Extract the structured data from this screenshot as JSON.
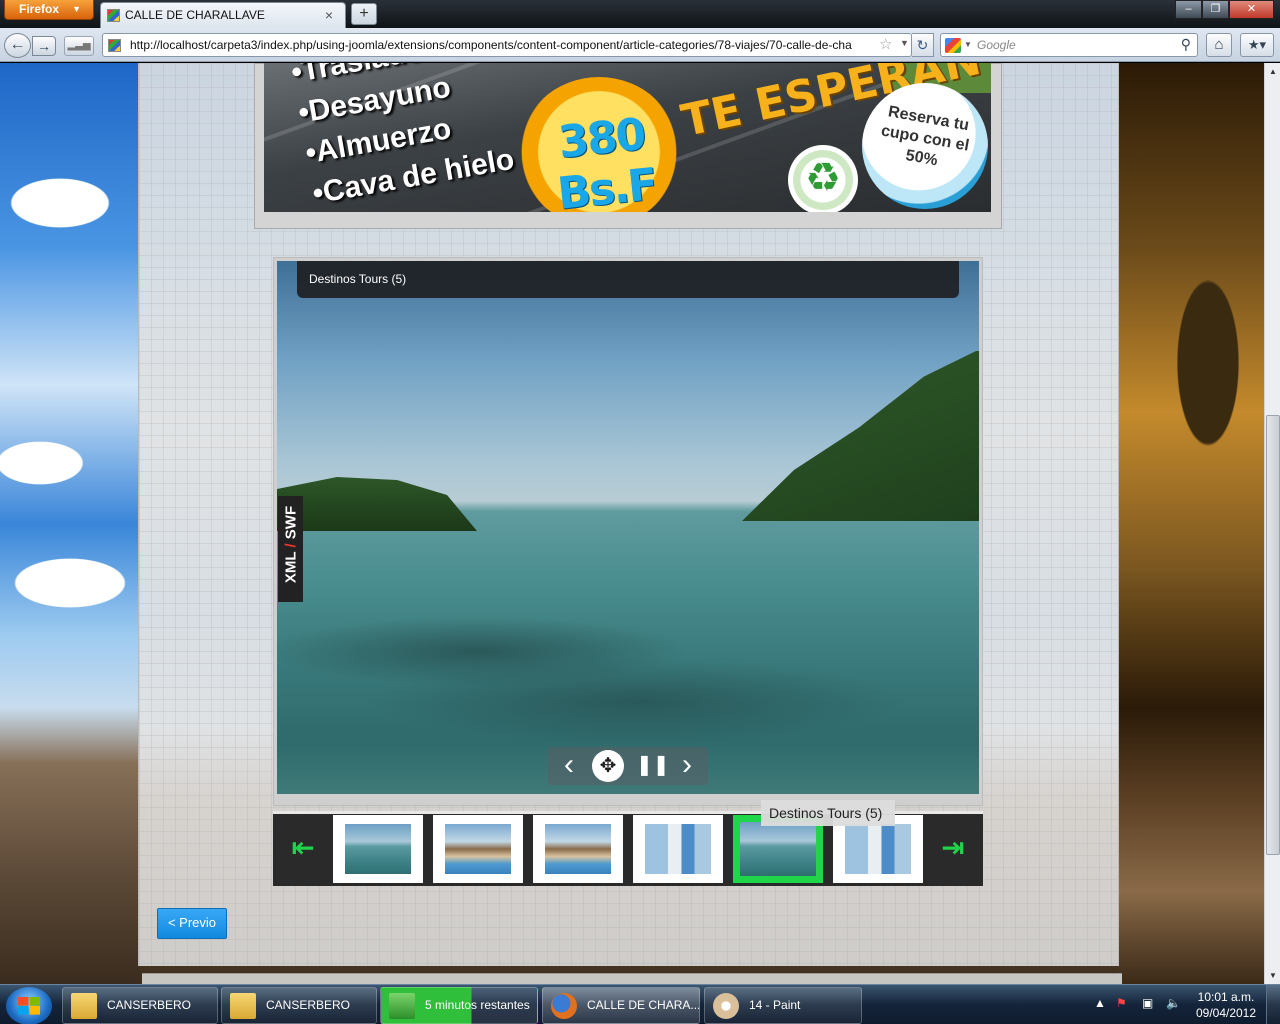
{
  "browser": {
    "app_button": "Firefox",
    "tab_title": "CALLE DE CHARALLAVE",
    "new_tab": "+",
    "url": "http://localhost/carpeta3/index.php/using-joomla/extensions/components/content-component/article-categories/78-viajes/70-calle-de-cha",
    "search_placeholder": "Google"
  },
  "banner": {
    "items": [
      "•Traslado en",
      "•Desayuno",
      "•Almuerzo",
      "•Cava de hielo"
    ],
    "price": "380 Bs.F",
    "headline": "TE ESPERAN",
    "bubble_text": "Reserva tu cupo con el 50%"
  },
  "gallery": {
    "caption": "Destinos Tours (5)",
    "side_label_left": "XML",
    "side_label_sep": "/",
    "side_label_right": "SWF",
    "tooltip": "Destinos Tours (5)",
    "selected_index": 4,
    "thumbnails": [
      {
        "subject": "beach"
      },
      {
        "subject": "water-park"
      },
      {
        "subject": "water-park"
      },
      {
        "subject": "water-slide"
      },
      {
        "subject": "beach"
      },
      {
        "subject": "water-slide"
      }
    ]
  },
  "pager": {
    "prev_label": "< Previo"
  },
  "taskbar": {
    "tasks": [
      {
        "label": "CANSERBERO",
        "icon": "folder-icon"
      },
      {
        "label": "CANSERBERO",
        "icon": "folder-icon"
      },
      {
        "label": "5 minutos restantes",
        "icon": "file-transfer-icon"
      },
      {
        "label": "CALLE DE CHARA...",
        "icon": "firefox-icon"
      },
      {
        "label": "14 - Paint",
        "icon": "paint-icon"
      }
    ],
    "time": "10:01 a.m.",
    "date": "09/04/2012"
  },
  "colors": {
    "accent_button": "#1289e0",
    "thumb_selected": "#1fd64a",
    "side_label_separator": "#e33333"
  }
}
